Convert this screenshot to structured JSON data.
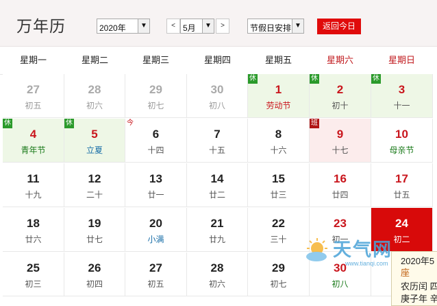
{
  "header": {
    "title": "万年历",
    "year_select": "2020年",
    "prev_month": "<",
    "month_select": "5月",
    "next_month": ">",
    "holiday_select": "节假日安排",
    "today_button": "返回今日"
  },
  "weekdays": [
    "星期一",
    "星期二",
    "星期三",
    "星期四",
    "星期五",
    "星期六",
    "星期日"
  ],
  "weeks": [
    [
      {
        "day": "27",
        "sub": "初五",
        "other": true
      },
      {
        "day": "28",
        "sub": "初六",
        "other": true
      },
      {
        "day": "29",
        "sub": "初七",
        "other": true
      },
      {
        "day": "30",
        "sub": "初八",
        "other": true
      },
      {
        "day": "1",
        "sub": "劳动节",
        "tag": "休",
        "red": true,
        "holiday": true,
        "subclass": "fest-red"
      },
      {
        "day": "2",
        "sub": "初十",
        "tag": "休",
        "red": true,
        "holiday": true
      },
      {
        "day": "3",
        "sub": "十一",
        "tag": "休",
        "red": true,
        "holiday": true
      }
    ],
    [
      {
        "day": "4",
        "sub": "青年节",
        "tag": "休",
        "red": true,
        "holiday": true,
        "subclass": "fest-green"
      },
      {
        "day": "5",
        "sub": "立夏",
        "tag": "休",
        "red": true,
        "holiday": true,
        "subclass": "fest-teal"
      },
      {
        "day": "6",
        "sub": "十四",
        "tag": "今",
        "tagclass": "jin"
      },
      {
        "day": "7",
        "sub": "十五"
      },
      {
        "day": "8",
        "sub": "十六"
      },
      {
        "day": "9",
        "sub": "十七",
        "tag": "班",
        "tagclass": "ban",
        "red": true,
        "workday": true
      },
      {
        "day": "10",
        "sub": "母亲节",
        "red": true,
        "subclass": "fest-green"
      }
    ],
    [
      {
        "day": "11",
        "sub": "十九"
      },
      {
        "day": "12",
        "sub": "二十"
      },
      {
        "day": "13",
        "sub": "廿一"
      },
      {
        "day": "14",
        "sub": "廿二"
      },
      {
        "day": "15",
        "sub": "廿三"
      },
      {
        "day": "16",
        "sub": "廿四",
        "red": true
      },
      {
        "day": "17",
        "sub": "廿五",
        "red": true
      }
    ],
    [
      {
        "day": "18",
        "sub": "廿六"
      },
      {
        "day": "19",
        "sub": "廿七"
      },
      {
        "day": "20",
        "sub": "小满",
        "subclass": "fest-teal"
      },
      {
        "day": "21",
        "sub": "廿九"
      },
      {
        "day": "22",
        "sub": "三十"
      },
      {
        "day": "23",
        "sub": "初一",
        "red": true
      },
      {
        "day": "24",
        "sub": "初二",
        "today": true
      }
    ],
    [
      {
        "day": "25",
        "sub": "初三"
      },
      {
        "day": "26",
        "sub": "初四"
      },
      {
        "day": "27",
        "sub": "初五"
      },
      {
        "day": "28",
        "sub": "初六"
      },
      {
        "day": "29",
        "sub": "初七"
      },
      {
        "day": "30",
        "sub": "初八",
        "red": true,
        "subclass": "fest-green"
      },
      {
        "day": "",
        "sub": ""
      }
    ]
  ],
  "popup": {
    "line1": "2020年5",
    "line2": "座",
    "line3": "农历闰 四",
    "line4": "庚子年 辛"
  },
  "watermark": {
    "text": "天气网",
    "url": "www.tianqi.com"
  }
}
